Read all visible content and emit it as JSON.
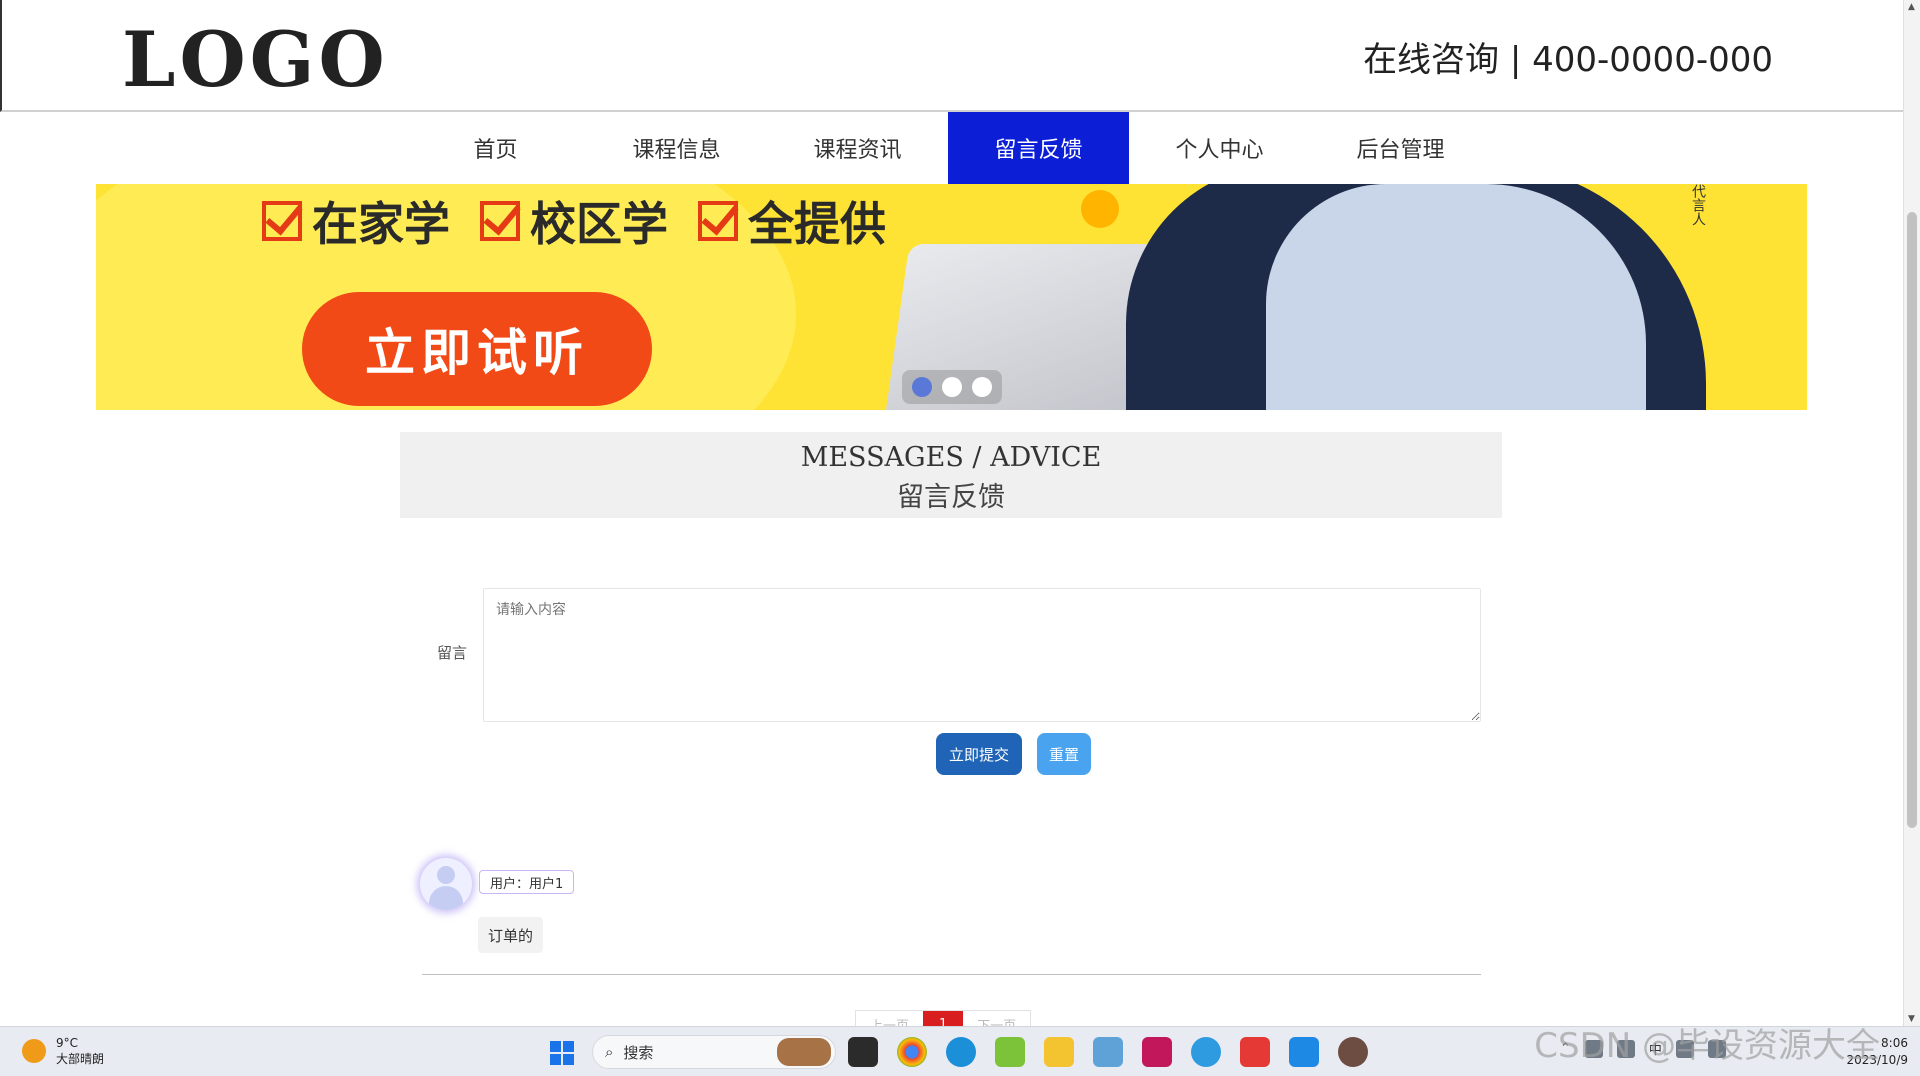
{
  "header": {
    "logo": "LOGO",
    "hotline": "在线咨询 | 400-0000-000"
  },
  "nav": {
    "items": [
      {
        "label": "首页"
      },
      {
        "label": "课程信息"
      },
      {
        "label": "课程资讯"
      },
      {
        "label": "留言反馈",
        "active": true
      },
      {
        "label": "个人中心"
      },
      {
        "label": "后台管理"
      }
    ]
  },
  "banner": {
    "features": [
      "在家学",
      "校区学",
      "全提供"
    ],
    "cta": "立即试听",
    "side_text": "代言人",
    "slide_count": 3,
    "active_slide": 1
  },
  "section": {
    "title_en": "MESSAGES / ADVICE",
    "title_cn": "留言反馈"
  },
  "form": {
    "label": "留言",
    "placeholder": "请输入内容",
    "value": "",
    "submit_label": "立即提交",
    "reset_label": "重置"
  },
  "comments": [
    {
      "user": "用户：用户1",
      "text": "订单的"
    }
  ],
  "pager": {
    "prev": "上一页",
    "current": "1",
    "next": "下一页"
  },
  "taskbar": {
    "weather_temp": "9°C",
    "weather_desc": "大部晴朗",
    "search_placeholder": "搜索",
    "apps": [
      "file-view-icon",
      "chrome-icon",
      "edge-icon",
      "plant-app-icon",
      "file-explorer-icon",
      "network-app-icon",
      "intellij-icon",
      "browser-alt-icon",
      "wps-icon",
      "notepad-icon",
      "media-app-icon"
    ],
    "tray_ime": "中",
    "time": "8:06",
    "date": "2023/10/9"
  },
  "watermark": "CSDN @毕设资源大全",
  "colors": {
    "nav_active": "#0c1fd6",
    "banner_bg": "#ffe334",
    "cta": "#f24a16",
    "submit": "#1f64b6",
    "reset": "#4aa3ee",
    "pager_current": "#d81e1e"
  }
}
